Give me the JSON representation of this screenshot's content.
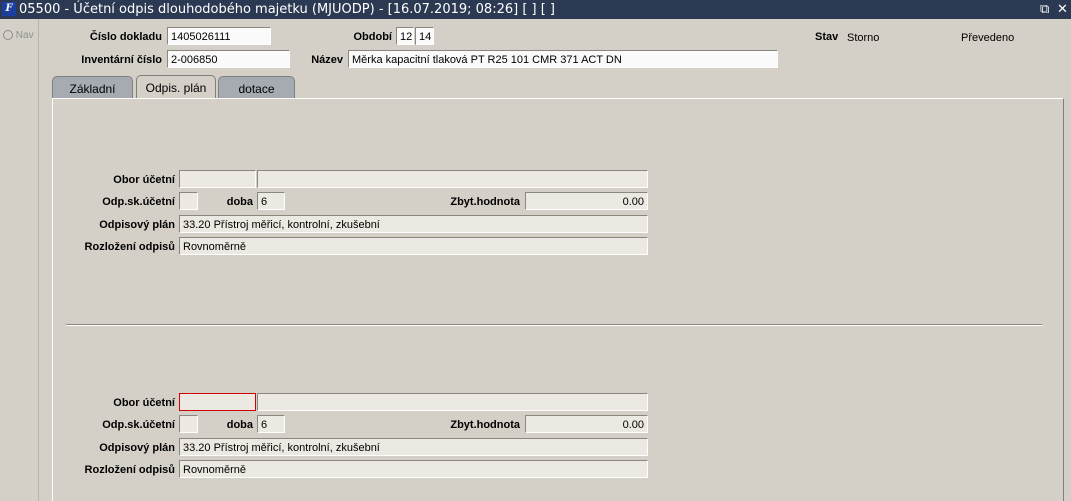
{
  "window": {
    "title": "05500 - Účetní odpis dlouhodobého majetku (MJUODP) - [16.07.2019; 08:26]  [ ]  [ ]",
    "icon_label": "F",
    "controls": {
      "restore": "⧉",
      "close": "✕"
    }
  },
  "sidebar": {
    "nav_label": "Nav"
  },
  "header": {
    "doc_number_label": "Číslo dokladu",
    "doc_number_value": "1405026111",
    "period_label": "Období",
    "period_month": "12",
    "period_year": "14",
    "status_label": "Stav",
    "status_value": "Storno",
    "status_extra": "Převedeno",
    "inventory_label": "Inventární číslo",
    "inventory_value": "2-006850",
    "name_label": "Název",
    "name_value": "Měrka kapacitní tlaková PT R25 101 CMR 371 ACT DN"
  },
  "tabs": [
    {
      "label": "Základní"
    },
    {
      "label": "Odpis. plán"
    },
    {
      "label": "dotace"
    }
  ],
  "sections": [
    {
      "obor_label": "Obor účetní",
      "obor_code": "",
      "obor_name": "",
      "odp_sk_label": "Odp.sk.účetní",
      "odp_sk_value": "",
      "doba_label": "doba",
      "doba_value": "6",
      "zbyt_label": "Zbyt.hodnota",
      "zbyt_value": "0.00",
      "plan_label": "Odpisový plán",
      "plan_value": "33.20 Přístroj měřicí, kontrolní, zkušební",
      "rozlozeni_label": "Rozložení odpisů",
      "rozlozeni_value": "Rovnoměrně"
    },
    {
      "obor_label": "Obor účetní",
      "obor_code": "",
      "obor_name": "",
      "odp_sk_label": "Odp.sk.účetní",
      "odp_sk_value": "",
      "doba_label": "doba",
      "doba_value": "6",
      "zbyt_label": "Zbyt.hodnota",
      "zbyt_value": "0.00",
      "plan_label": "Odpisový plán",
      "plan_value": "33.20 Přístroj měřicí, kontrolní, zkušební",
      "rozlozeni_label": "Rozložení odpisů",
      "rozlozeni_value": "Rovnoměrně"
    }
  ],
  "colors": {
    "titlebar": "#2b3a52",
    "background": "#d4d0c8",
    "error_border": "#d10000",
    "inactive_tab": "#a6abb2"
  }
}
